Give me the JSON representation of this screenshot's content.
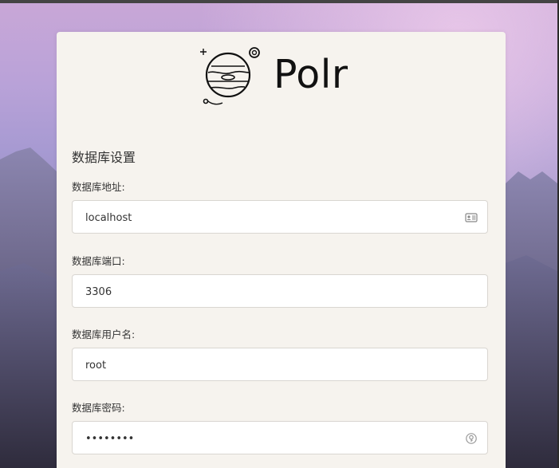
{
  "brand": {
    "name": "Polr"
  },
  "form": {
    "section_title": "数据库设置",
    "fields": [
      {
        "label": "数据库地址:",
        "value": "localhost",
        "icon": "contact-card-icon"
      },
      {
        "label": "数据库端口:",
        "value": "3306"
      },
      {
        "label": "数据库用户名:",
        "value": "root"
      },
      {
        "label": "数据库密码:",
        "value": "••••••••",
        "icon": "password-key-icon"
      }
    ]
  },
  "colors": {
    "card_background": "#f6f3ee",
    "input_border": "#d9d6d1",
    "text": "#333333"
  }
}
